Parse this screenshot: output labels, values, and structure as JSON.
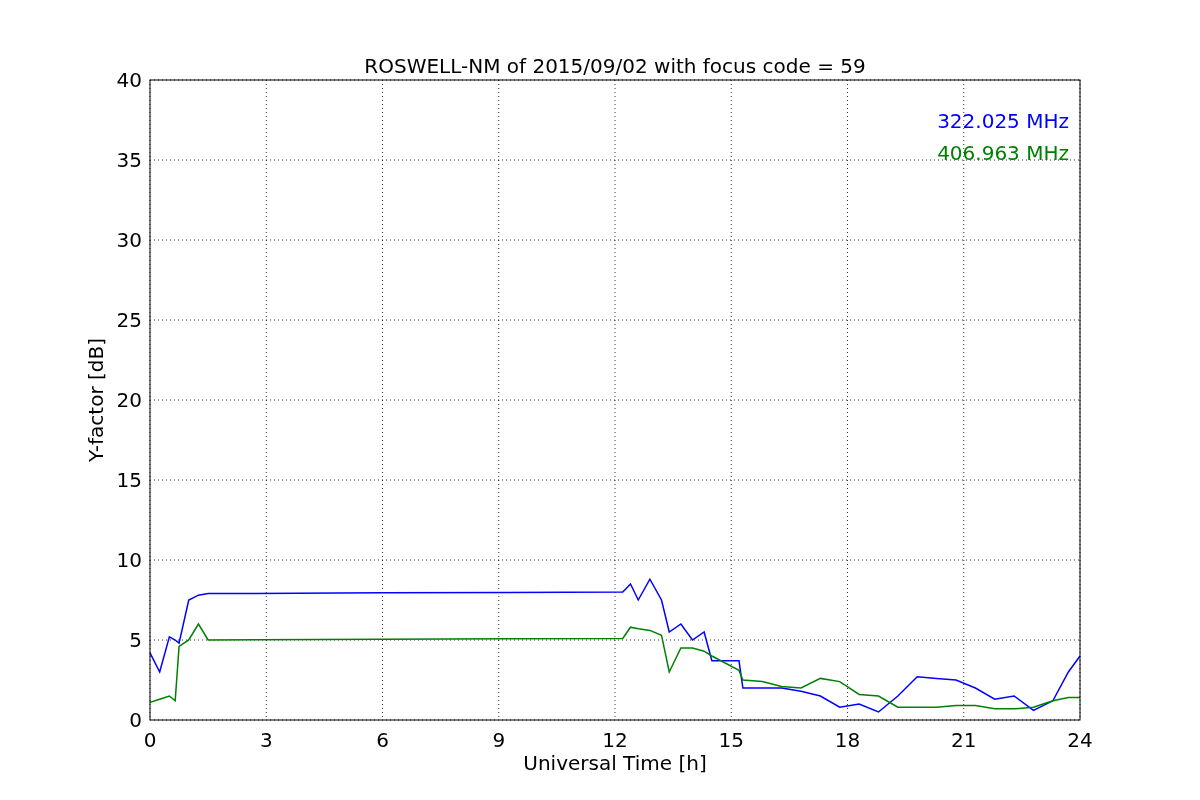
{
  "chart_data": {
    "type": "line",
    "title": "ROSWELL-NM of 2015/09/02 with focus code = 59",
    "xlabel": "Universal Time [h]",
    "ylabel": "Y-factor [dB]",
    "x": [
      0,
      0.25,
      0.5,
      0.65,
      0.75,
      1,
      1.25,
      1.5,
      6,
      12.2,
      12.4,
      12.6,
      12.9,
      13.2,
      13.4,
      13.7,
      14,
      14.3,
      14.5,
      15.2,
      15.3,
      15.8,
      16.3,
      16.8,
      17.3,
      17.8,
      18.3,
      18.8,
      19.3,
      19.8,
      20.3,
      20.8,
      21.3,
      21.8,
      22.3,
      22.8,
      23.3,
      23.7,
      24
    ],
    "series": [
      {
        "name": "322.025 MHz",
        "color": "#0000ff",
        "values": [
          4.2,
          3.0,
          5.2,
          5.0,
          4.8,
          7.5,
          7.8,
          7.9,
          7.95,
          8.0,
          8.5,
          7.5,
          8.8,
          7.5,
          5.5,
          6.0,
          5.0,
          5.5,
          3.7,
          3.7,
          2.0,
          2.0,
          2.0,
          1.8,
          1.5,
          0.8,
          1.0,
          0.5,
          1.5,
          2.7,
          2.6,
          2.5,
          2.0,
          1.3,
          1.5,
          0.6,
          1.2,
          3.0,
          4.0
        ]
      },
      {
        "name": "406.963 MHz",
        "color": "#008000",
        "values": [
          1.1,
          1.3,
          1.5,
          1.2,
          4.6,
          5.0,
          6.0,
          5.0,
          5.05,
          5.1,
          5.8,
          5.7,
          5.6,
          5.3,
          3.0,
          4.5,
          4.5,
          4.3,
          4.0,
          3.1,
          2.5,
          2.4,
          2.1,
          2.0,
          2.6,
          2.4,
          1.6,
          1.5,
          0.8,
          0.8,
          0.8,
          0.9,
          0.9,
          0.7,
          0.7,
          0.8,
          1.2,
          1.4,
          1.4
        ]
      }
    ],
    "grid": true,
    "xlim": [
      0,
      24
    ],
    "ylim": [
      0,
      40
    ],
    "xticks": [
      0,
      3,
      6,
      9,
      12,
      15,
      18,
      21,
      24
    ],
    "yticks": [
      0,
      5,
      10,
      15,
      20,
      25,
      30,
      35,
      40
    ]
  }
}
